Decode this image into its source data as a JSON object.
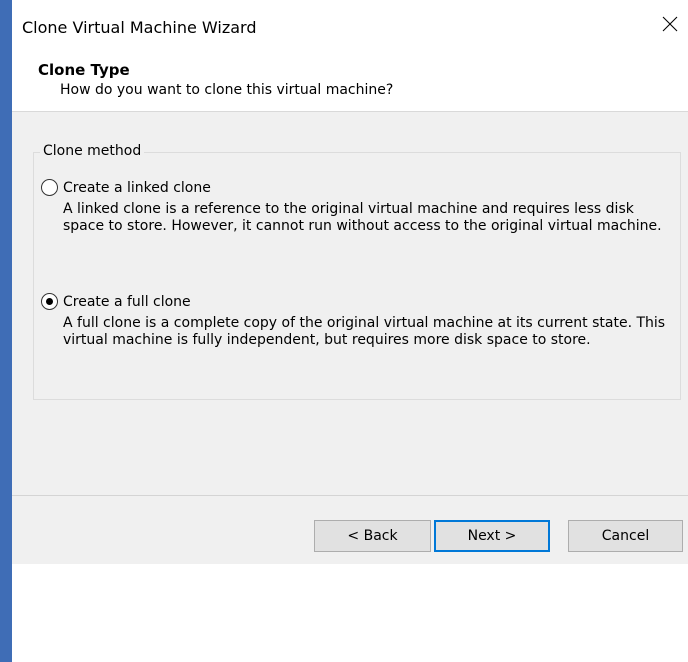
{
  "window": {
    "title": "Clone Virtual Machine Wizard",
    "close_glyph": "✕",
    "accent_color": "#3f6db6"
  },
  "header": {
    "title": "Clone Type",
    "subtitle": "How do you want to clone this virtual machine?"
  },
  "clone_method": {
    "legend": "Clone method",
    "options": [
      {
        "label": "Create a linked clone",
        "description": "A linked clone is a reference to the original virtual machine and requires less disk space to store. However, it cannot run without access to the original virtual machine.",
        "selected": false
      },
      {
        "label": "Create a full clone",
        "description": "A full clone is a complete copy of the original virtual machine at its current state. This virtual machine is fully independent, but requires more disk space to store.",
        "selected": true
      }
    ]
  },
  "buttons": {
    "back": "< Back",
    "next": "Next >",
    "cancel": "Cancel"
  },
  "colors": {
    "default_button_border": "#0078d7",
    "content_background": "#f0f0f0"
  }
}
